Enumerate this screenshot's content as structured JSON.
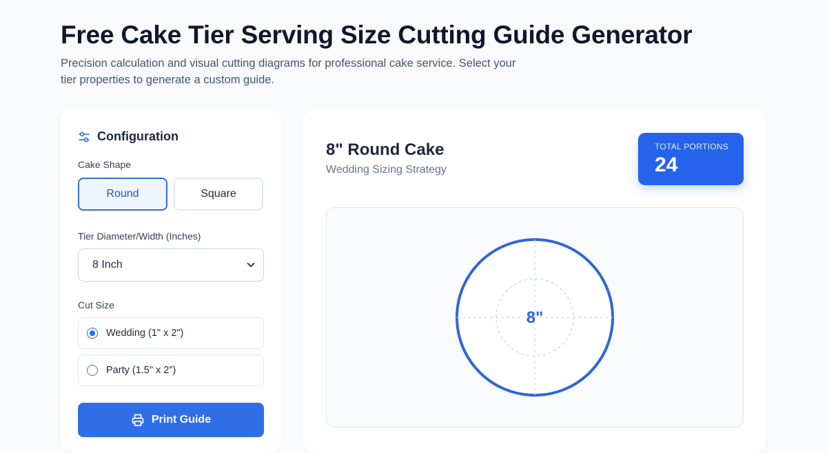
{
  "header": {
    "title": "Free Cake Tier Serving Size Cutting Guide Generator",
    "subtitle": "Precision calculation and visual cutting diagrams for professional cake service. Select your tier properties to generate a custom guide."
  },
  "config": {
    "title": "Configuration",
    "icon": "sliders-icon",
    "shape_label": "Cake Shape",
    "shapes": [
      "Round",
      "Square"
    ],
    "selected_shape": "Round",
    "diameter_label": "Tier Diameter/Width (Inches)",
    "diameter_value": "8 Inch",
    "cut_label": "Cut Size",
    "cut_options": [
      "Wedding (1\" x 2\")",
      "Party (1.5\" x 2\")"
    ],
    "selected_cut": "Wedding (1\" x 2\")",
    "print_label": "Print Guide",
    "print_icon": "printer-icon"
  },
  "result": {
    "title": "8\" Round Cake",
    "strategy": "Wedding Sizing Strategy",
    "portions_label": "TOTAL PORTIONS",
    "portions_value": "24",
    "diagram_label": "8\""
  },
  "colors": {
    "accent": "#2563eb",
    "circle_stroke": "#2f66d6",
    "background": "#f8fafc"
  }
}
